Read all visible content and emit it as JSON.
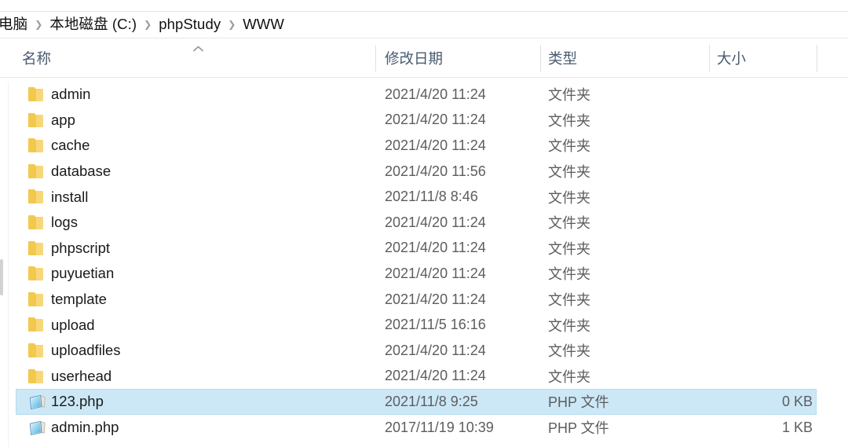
{
  "breadcrumb": {
    "items": [
      {
        "label": "电脑"
      },
      {
        "label": "本地磁盘 (C:)"
      },
      {
        "label": "phpStudy"
      },
      {
        "label": "WWW"
      }
    ],
    "separator": "❯"
  },
  "columns": {
    "name": "名称",
    "date_modified": "修改日期",
    "type": "类型",
    "size": "大小",
    "sort_indicator": "ascending-caret"
  },
  "colors": {
    "selection_fill": "#cce8f7",
    "selection_border": "#b4dcf0",
    "folder_icon": "#f7d779",
    "header_text": "#4a5a70",
    "secondary_text": "#5d5d5d"
  },
  "files": [
    {
      "name": "admin",
      "date": "2021/4/20 11:24",
      "type": "文件夹",
      "size": "",
      "icon": "folder-icon",
      "selected": false
    },
    {
      "name": "app",
      "date": "2021/4/20 11:24",
      "type": "文件夹",
      "size": "",
      "icon": "folder-icon",
      "selected": false
    },
    {
      "name": "cache",
      "date": "2021/4/20 11:24",
      "type": "文件夹",
      "size": "",
      "icon": "folder-icon",
      "selected": false
    },
    {
      "name": "database",
      "date": "2021/4/20 11:56",
      "type": "文件夹",
      "size": "",
      "icon": "folder-icon",
      "selected": false
    },
    {
      "name": "install",
      "date": "2021/11/8 8:46",
      "type": "文件夹",
      "size": "",
      "icon": "folder-icon",
      "selected": false
    },
    {
      "name": "logs",
      "date": "2021/4/20 11:24",
      "type": "文件夹",
      "size": "",
      "icon": "folder-icon",
      "selected": false
    },
    {
      "name": "phpscript",
      "date": "2021/4/20 11:24",
      "type": "文件夹",
      "size": "",
      "icon": "folder-icon",
      "selected": false
    },
    {
      "name": "puyuetian",
      "date": "2021/4/20 11:24",
      "type": "文件夹",
      "size": "",
      "icon": "folder-icon",
      "selected": false
    },
    {
      "name": "template",
      "date": "2021/4/20 11:24",
      "type": "文件夹",
      "size": "",
      "icon": "folder-icon",
      "selected": false
    },
    {
      "name": "upload",
      "date": "2021/11/5 16:16",
      "type": "文件夹",
      "size": "",
      "icon": "folder-icon",
      "selected": false
    },
    {
      "name": "uploadfiles",
      "date": "2021/4/20 11:24",
      "type": "文件夹",
      "size": "",
      "icon": "folder-icon",
      "selected": false
    },
    {
      "name": "userhead",
      "date": "2021/4/20 11:24",
      "type": "文件夹",
      "size": "",
      "icon": "folder-icon",
      "selected": false
    },
    {
      "name": "123.php",
      "date": "2021/11/8 9:25",
      "type": "PHP 文件",
      "size": "0 KB",
      "icon": "php-file-icon",
      "selected": true
    },
    {
      "name": "admin.php",
      "date": "2017/11/19 10:39",
      "type": "PHP 文件",
      "size": "1 KB",
      "icon": "php-file-icon",
      "selected": false
    }
  ]
}
